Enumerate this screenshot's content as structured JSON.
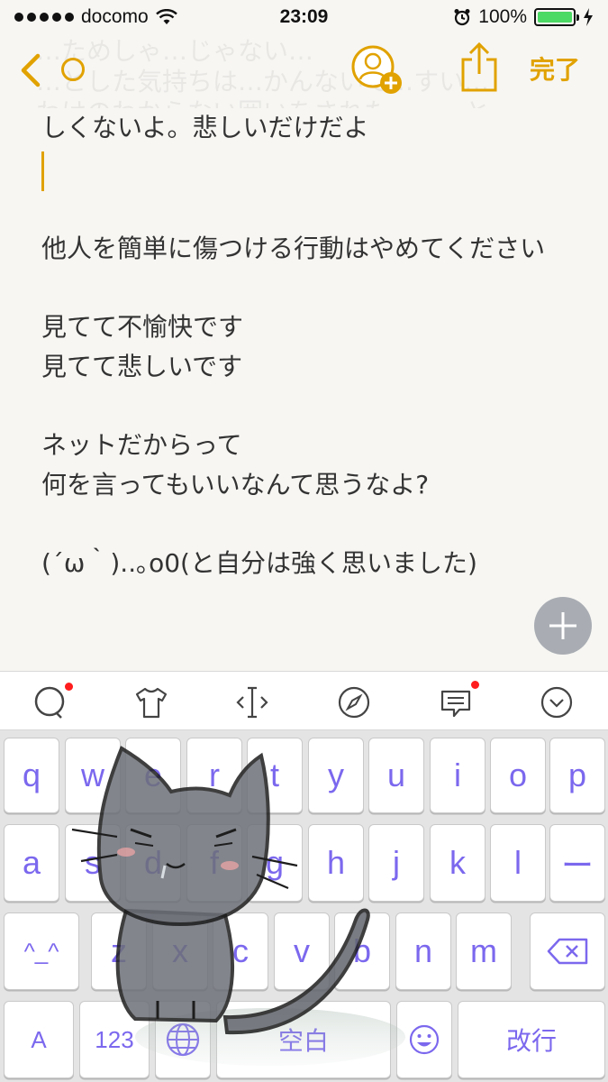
{
  "status_bar": {
    "carrier": "docomo",
    "time": "23:09",
    "battery_percent": "100%",
    "battery_level": 1.0
  },
  "nav": {
    "faint_text_line1": "…ためしゃ…じゃない…",
    "faint_text_line2": "…とした気持ちは…かんないで…すい…",
    "faint_text_line3": "わけのわからない囲いをされた…　…と…",
    "done_label": "完了"
  },
  "note": {
    "lines": [
      "しくないよ。悲しいだけだよ",
      "他人を簡単に傷つける行動はやめてください",
      "見てて不愉快です",
      "見てて悲しいです",
      "ネットだからって",
      "何を言ってもいいなんて思うなよ?",
      "(´ω｀)..｡o0(と自分は強く思いました)"
    ]
  },
  "toolbar": {
    "icons": [
      "chat-bubble-icon",
      "tshirt-icon",
      "cursor-move-icon",
      "compass-icon",
      "message-icon",
      "chevron-down-icon"
    ],
    "accent_dot_color": "#ff1d1d"
  },
  "keyboard": {
    "row1": [
      "q",
      "w",
      "e",
      "r",
      "t",
      "y",
      "u",
      "i",
      "o",
      "p"
    ],
    "row2": [
      "a",
      "s",
      "d",
      "f",
      "g",
      "h",
      "j",
      "k",
      "l",
      "ー"
    ],
    "row3": [
      "^_^",
      "z",
      "x",
      "c",
      "v",
      "b",
      "n",
      "m"
    ],
    "row4": {
      "shift": "A",
      "numbers": "123",
      "space": "空白",
      "return": "改行"
    },
    "key_text_color": "#7b68ee"
  },
  "colors": {
    "accent": "#e1a200",
    "background": "#f7f6f3"
  }
}
